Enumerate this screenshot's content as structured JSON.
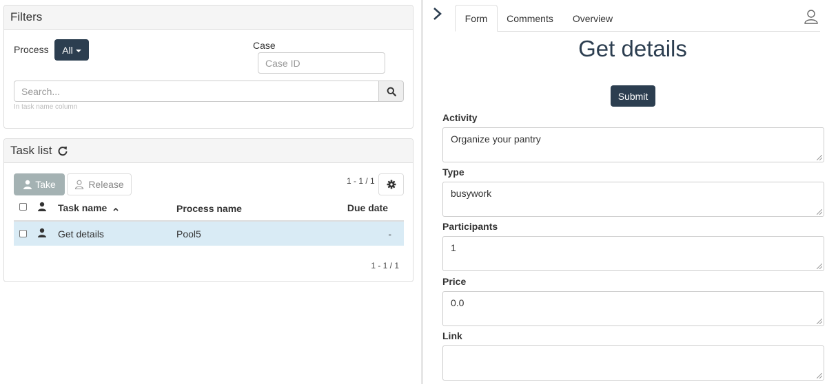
{
  "filters": {
    "title": "Filters",
    "process_label": "Process",
    "process_value": "All",
    "case_label": "Case",
    "case_placeholder": "Case ID",
    "search_placeholder": "Search...",
    "search_help": "In task name column"
  },
  "tasklist": {
    "title": "Task list",
    "take_label": "Take",
    "release_label": "Release",
    "pager_top": "1 - 1 / 1",
    "pager_bottom": "1 - 1 / 1",
    "columns": [
      "Task name",
      "Process name",
      "Due date"
    ],
    "rows": [
      {
        "task_name": "Get details",
        "process_name": "Pool5",
        "due_date": "-"
      }
    ]
  },
  "tabs": [
    {
      "label": "Form"
    },
    {
      "label": "Comments"
    },
    {
      "label": "Overview"
    }
  ],
  "form": {
    "title": "Get details",
    "submit_label": "Submit",
    "fields": [
      {
        "label": "Activity",
        "value": "Organize your pantry"
      },
      {
        "label": "Type",
        "value": "busywork"
      },
      {
        "label": "Participants",
        "value": "1"
      },
      {
        "label": "Price",
        "value": "0.0"
      },
      {
        "label": "Link",
        "value": ""
      }
    ]
  },
  "colors": {
    "primary": "#2c3e50",
    "selected_row": "#d9ebf5",
    "disabled_button": "#95a5a6"
  },
  "icons": [
    "search-icon",
    "refresh-icon",
    "user-icon",
    "user-outline-icon",
    "gear-icon",
    "chevron-right-icon",
    "sort-up-icon"
  ]
}
